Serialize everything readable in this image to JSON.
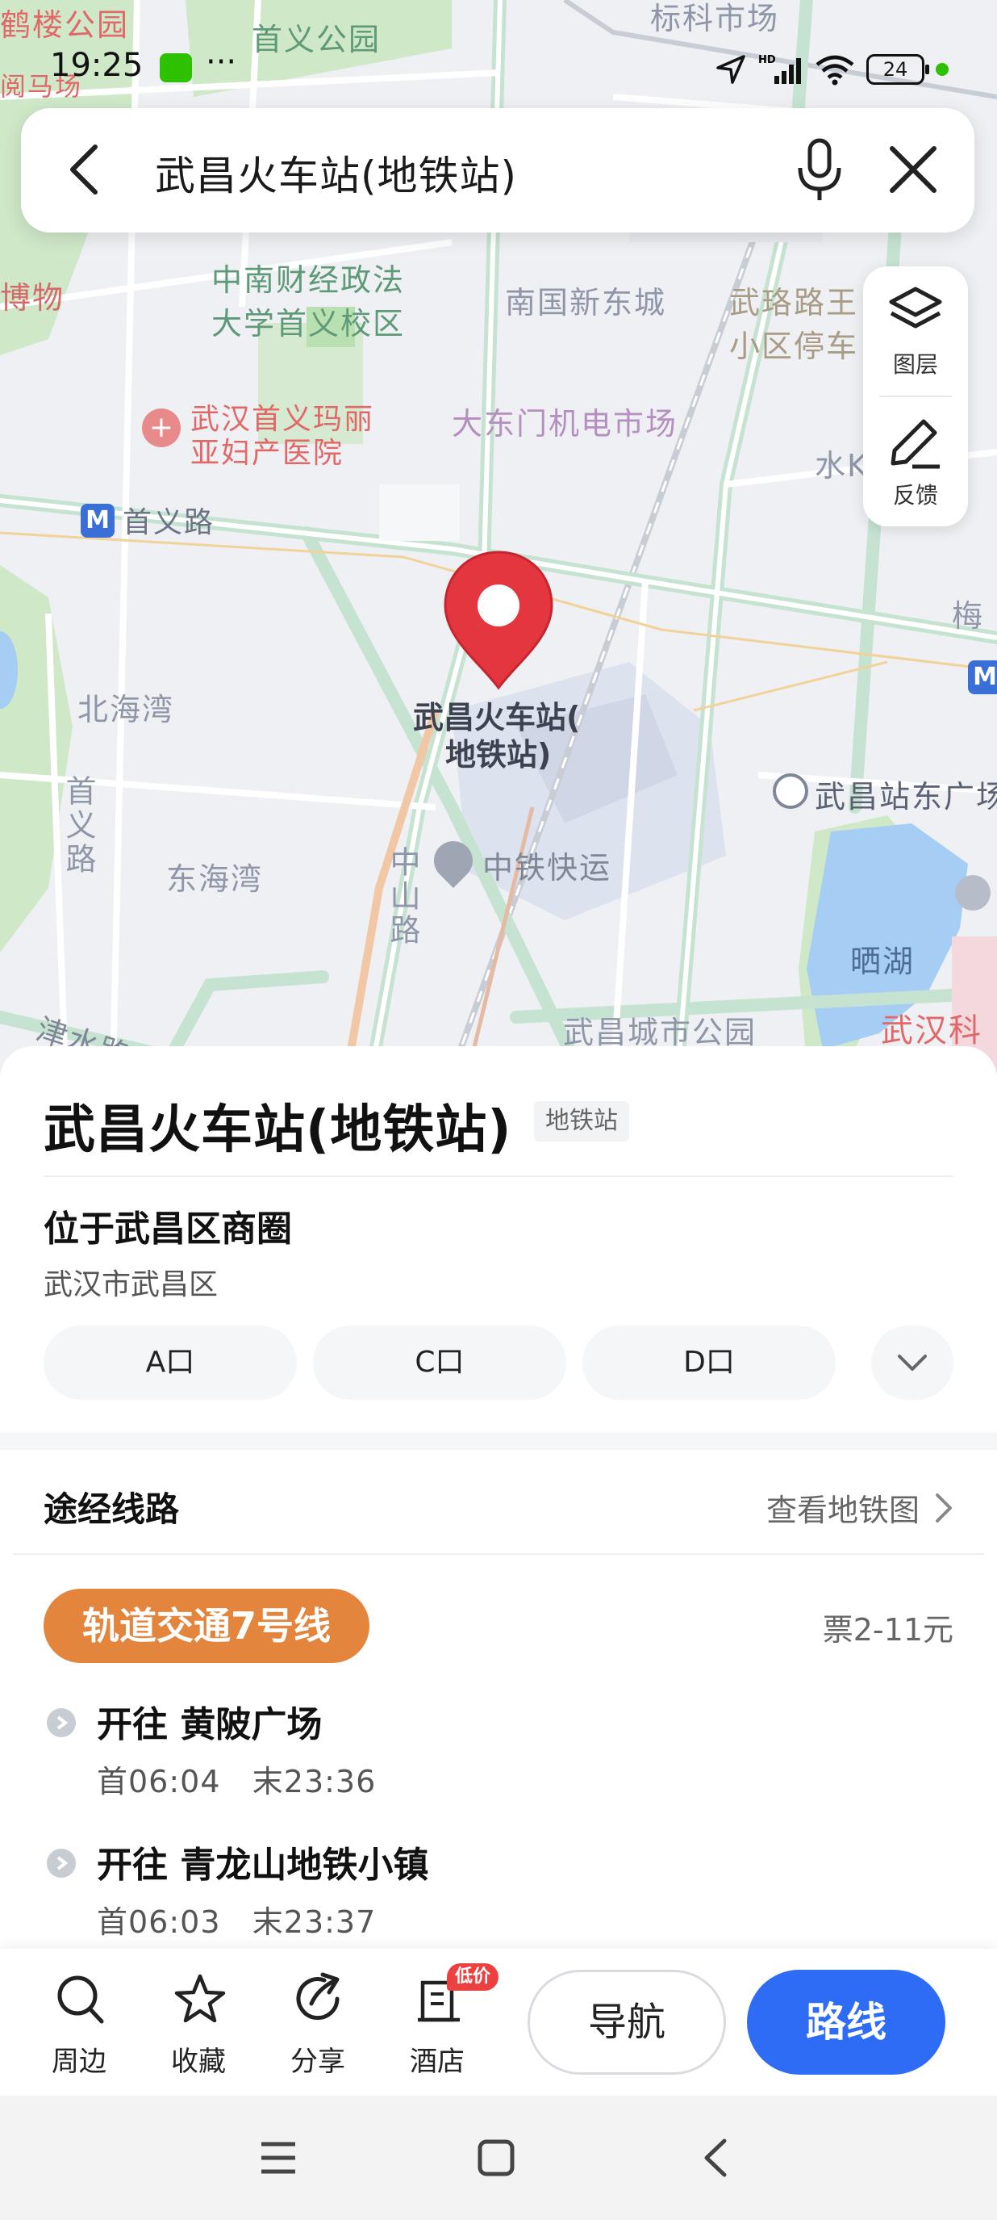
{
  "status_bar": {
    "time": "19:25",
    "more": "···",
    "battery": "24",
    "icons": [
      "wechat-icon",
      "location-icon",
      "signal-icon",
      "wifi-icon",
      "battery-icon"
    ]
  },
  "search": {
    "query": "武昌火车站(地铁站)"
  },
  "map": {
    "labels": {
      "shouyi_park": "首义公园",
      "zhongnan_univ_1": "中南财经政法",
      "zhongnan_univ_2": "大学首义校区",
      "nanguo": "南国新东城",
      "wuluolu_1": "武珞路王",
      "wuluolu_2": "小区停车",
      "hospital_1": "武汉首义玛丽",
      "hospital_2": "亚妇产医院",
      "dadongmen": "大东门机电市场",
      "shuiguo": "水K",
      "shouyilu_metro": "首义路",
      "mei": "梅",
      "beihaiwan": "北海湾",
      "donghaiwan": "东海湾",
      "shouyilu_road": "首义路",
      "zhongshan_road": "中山路",
      "zhongtie": "中铁快运",
      "east_square": "武昌站东广场",
      "shaihu": "晒湖",
      "wuchang_park": "武昌城市公园",
      "jinshui": "津水路",
      "wuhan_ke": "武汉科",
      "yuemalu": "阅马场",
      "bowu": "博物",
      "biaoke": "标科市场",
      "top_left": "鹤楼公园",
      "marker_1": "武昌火车站(",
      "marker_2": "地铁站)"
    },
    "tools": {
      "layers": "图层",
      "feedback": "反馈"
    },
    "colors": {
      "road": "#cfe6d8",
      "water": "#a6cdf4",
      "park": "#cfe8c8",
      "marker": "#e4363f"
    }
  },
  "panel": {
    "title": "武昌火车站(地铁站)",
    "tag": "地铁站",
    "district_heading": "位于武昌区商圈",
    "district_sub": "武汉市武昌区",
    "exits": [
      "A口",
      "C口",
      "D口"
    ],
    "lines_heading": "途经线路",
    "subway_map_link": "查看地铁图",
    "line_name": "轨道交通7号线",
    "line_color": "#e3853d",
    "fare": "票2-11元",
    "directions": [
      {
        "dest": "开往 黄陂广场",
        "first": "首06:04",
        "last": "末23:36"
      },
      {
        "dest": "开往 青龙山地铁小镇",
        "first": "首06:03",
        "last": "末23:37"
      }
    ]
  },
  "actions": {
    "nearby": "周边",
    "favorite": "收藏",
    "share": "分享",
    "hotel": "酒店",
    "hotel_badge": "低价",
    "navigate": "导航",
    "route": "路线",
    "route_color": "#2f6cf6"
  }
}
